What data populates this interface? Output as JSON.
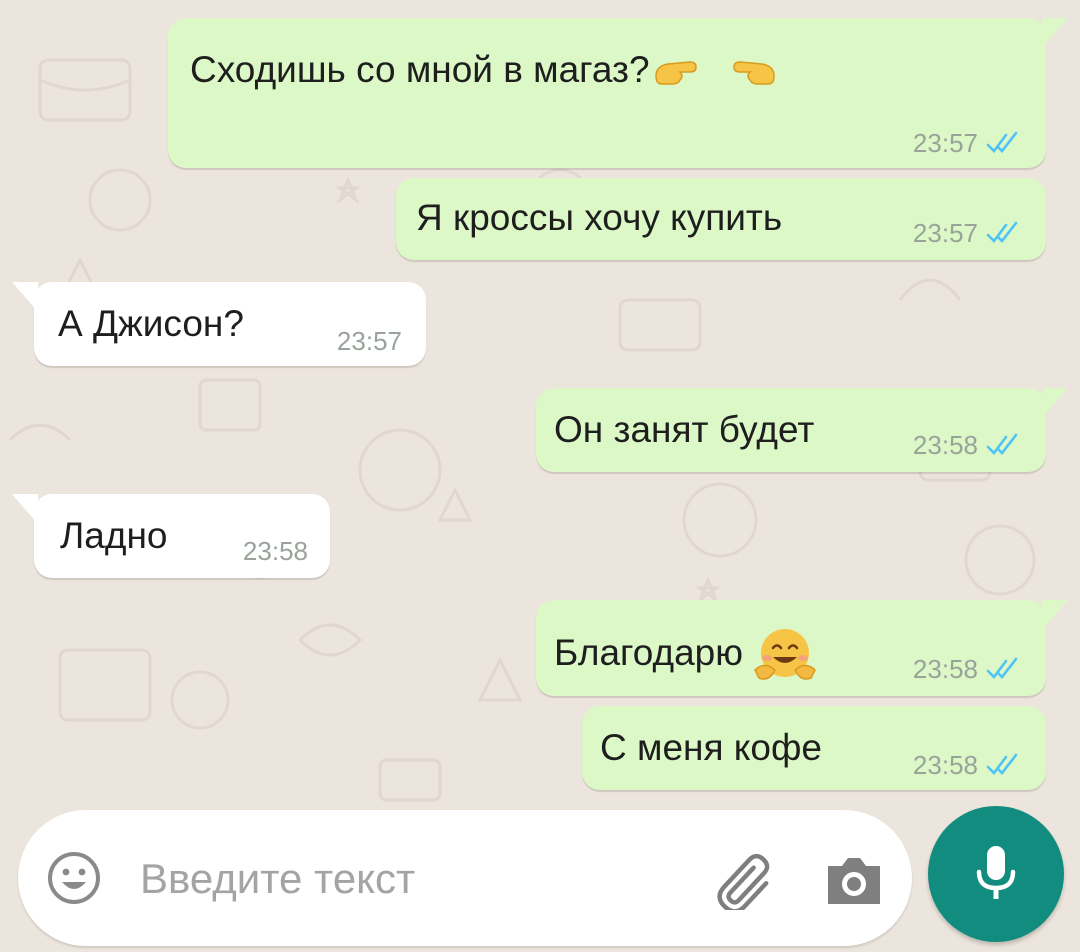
{
  "messages": [
    {
      "direction": "out",
      "text": "Сходишь со мной в магаз?",
      "emoji": "pointing-hands",
      "time": "23:57",
      "status": "read"
    },
    {
      "direction": "out",
      "text": "Я кроссы хочу купить",
      "time": "23:57",
      "status": "read"
    },
    {
      "direction": "in",
      "text": "А Джисон?",
      "time": "23:57"
    },
    {
      "direction": "out",
      "text": "Он занят будет",
      "time": "23:58",
      "status": "read"
    },
    {
      "direction": "in",
      "text": "Ладно",
      "time": "23:58"
    },
    {
      "direction": "out",
      "text": "Благодарю",
      "emoji": "hugging-face",
      "time": "23:58",
      "status": "read"
    },
    {
      "direction": "out",
      "text": "С меня кофе",
      "time": "23:58",
      "status": "read"
    }
  ],
  "input": {
    "placeholder": "Введите текст",
    "icons": {
      "emoji": "smiley-icon",
      "attach": "paperclip-icon",
      "camera": "camera-icon",
      "send": "mic-icon"
    }
  },
  "colors": {
    "background": "#ece5dd",
    "outgoing_bubble": "#dcf8c6",
    "incoming_bubble": "#ffffff",
    "read_ticks": "#4fc3f7",
    "accent": "#128c7e"
  }
}
